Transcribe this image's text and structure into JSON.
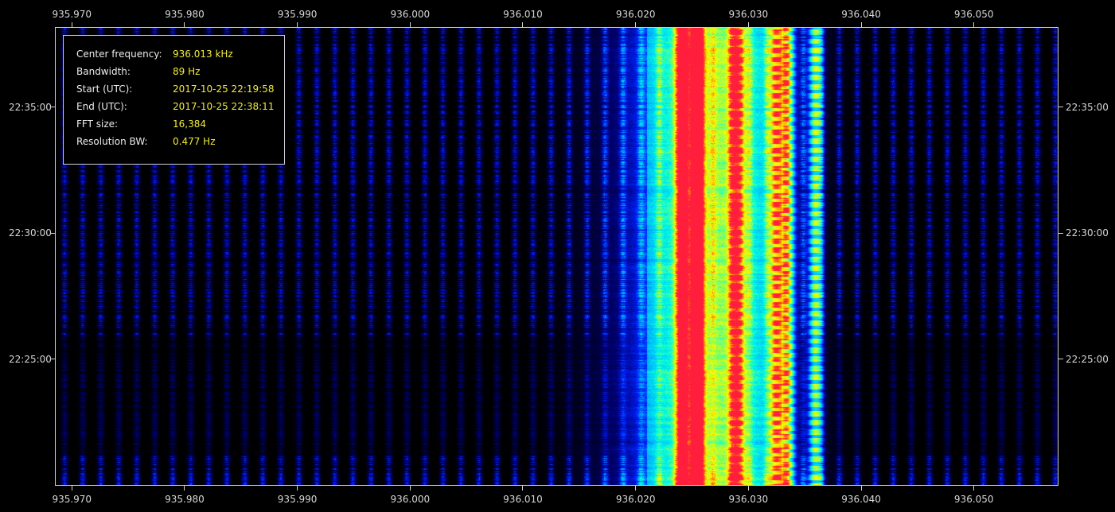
{
  "chart_data": {
    "type": "heatmap",
    "title": "",
    "xlabel": "",
    "ylabel": "",
    "x_unit": "kHz",
    "xlim": [
      935.9685,
      936.0575
    ],
    "ylim_utc": [
      "2017-10-25 22:19:58",
      "2017-10-25 22:38:11"
    ],
    "x_ticks": [
      "935.970",
      "935.980",
      "935.990",
      "936.000",
      "936.010",
      "936.020",
      "936.030",
      "936.040",
      "936.050"
    ],
    "x_tick_values": [
      935.97,
      935.98,
      935.99,
      936.0,
      936.01,
      936.02,
      936.03,
      936.04,
      936.05
    ],
    "y_ticks": [
      "22:35:00",
      "22:30:00",
      "22:25:00"
    ],
    "y_tick_values_minutes": [
      15.033,
      10.033,
      5.033
    ],
    "duration_minutes": 18.217,
    "colormap": [
      "#000000",
      "#00006e",
      "#0020ff",
      "#00b4ff",
      "#00ffe0",
      "#a0ff40",
      "#ffff00",
      "#ffa000",
      "#ff1e3c"
    ],
    "grid": false,
    "signals": [
      {
        "freq_khz": 936.0255,
        "strength": 1.0,
        "kind": "carrier"
      },
      {
        "freq_khz": 936.0242,
        "strength": 0.7,
        "kind": "carrier"
      },
      {
        "freq_khz": 936.029,
        "strength": 0.85,
        "kind": "intermittent"
      },
      {
        "freq_khz": 936.0325,
        "strength": 0.75,
        "kind": "intermittent"
      },
      {
        "freq_khz": 936.0335,
        "strength": 0.8,
        "kind": "intermittent"
      },
      {
        "freq_khz": 936.036,
        "strength": 0.7,
        "kind": "intermittent"
      }
    ]
  },
  "info_box": {
    "rows": [
      {
        "label": "Center frequency:",
        "value": "936.013 kHz"
      },
      {
        "label": "Bandwidth:",
        "value": "89 Hz"
      },
      {
        "label": "Start (UTC):",
        "value": "2017-10-25 22:19:58"
      },
      {
        "label": "End (UTC):",
        "value": "2017-10-25 22:38:11"
      },
      {
        "label": "FFT size:",
        "value": "16,384"
      },
      {
        "label": "Resolution BW:",
        "value": "0.477 Hz"
      }
    ]
  }
}
